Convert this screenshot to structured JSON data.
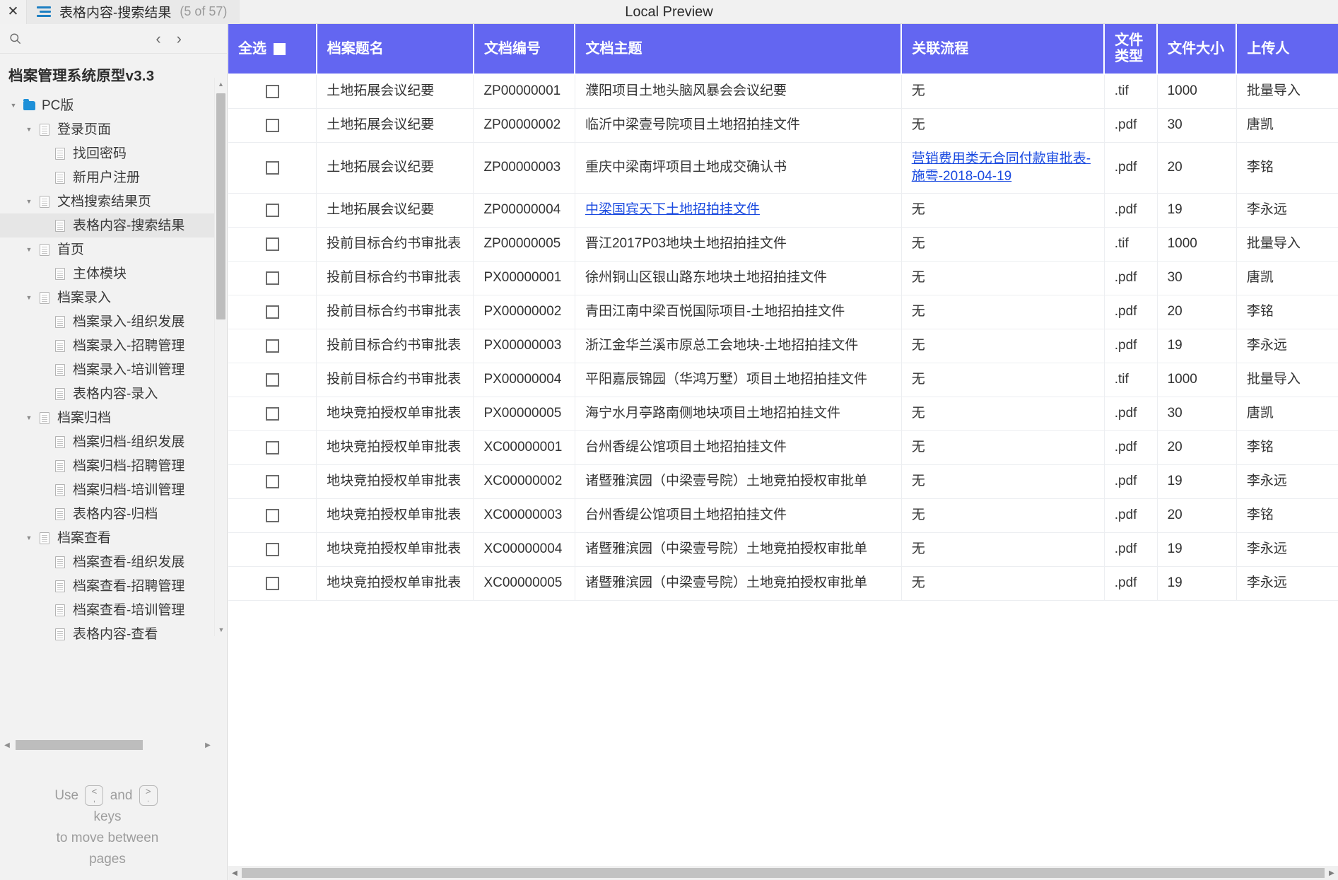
{
  "topbar": {
    "close_label": "✕",
    "tab_title": "表格内容-搜索结果",
    "tab_count": "(5 of 57)",
    "center_title": "Local Preview"
  },
  "sidebar": {
    "prev_label": "‹",
    "next_label": "›",
    "project_title": "档案管理系统原型v3.3",
    "tree": [
      {
        "label": "PC版",
        "depth": 0,
        "icon": "folder-icon",
        "caret": "▼",
        "selected": false
      },
      {
        "label": "登录页面",
        "depth": 1,
        "icon": "page-icon",
        "caret": "▼",
        "selected": false
      },
      {
        "label": "找回密码",
        "depth": 2,
        "icon": "page-icon",
        "caret": "",
        "selected": false
      },
      {
        "label": "新用户注册",
        "depth": 2,
        "icon": "page-icon",
        "caret": "",
        "selected": false
      },
      {
        "label": "文档搜索结果页",
        "depth": 1,
        "icon": "page-icon",
        "caret": "▼",
        "selected": false
      },
      {
        "label": "表格内容-搜索结果",
        "depth": 2,
        "icon": "page-icon",
        "caret": "",
        "selected": true
      },
      {
        "label": "首页",
        "depth": 1,
        "icon": "page-icon",
        "caret": "▼",
        "selected": false
      },
      {
        "label": "主体模块",
        "depth": 2,
        "icon": "page-icon",
        "caret": "",
        "selected": false
      },
      {
        "label": "档案录入",
        "depth": 1,
        "icon": "page-icon",
        "caret": "▼",
        "selected": false
      },
      {
        "label": "档案录入-组织发展",
        "depth": 2,
        "icon": "page-icon",
        "caret": "",
        "selected": false
      },
      {
        "label": "档案录入-招聘管理",
        "depth": 2,
        "icon": "page-icon",
        "caret": "",
        "selected": false
      },
      {
        "label": "档案录入-培训管理",
        "depth": 2,
        "icon": "page-icon",
        "caret": "",
        "selected": false
      },
      {
        "label": "表格内容-录入",
        "depth": 2,
        "icon": "page-icon",
        "caret": "",
        "selected": false
      },
      {
        "label": "档案归档",
        "depth": 1,
        "icon": "page-icon",
        "caret": "▼",
        "selected": false
      },
      {
        "label": "档案归档-组织发展",
        "depth": 2,
        "icon": "page-icon",
        "caret": "",
        "selected": false
      },
      {
        "label": "档案归档-招聘管理",
        "depth": 2,
        "icon": "page-icon",
        "caret": "",
        "selected": false
      },
      {
        "label": "档案归档-培训管理",
        "depth": 2,
        "icon": "page-icon",
        "caret": "",
        "selected": false
      },
      {
        "label": "表格内容-归档",
        "depth": 2,
        "icon": "page-icon",
        "caret": "",
        "selected": false
      },
      {
        "label": "档案查看",
        "depth": 1,
        "icon": "page-icon",
        "caret": "▼",
        "selected": false
      },
      {
        "label": "档案查看-组织发展",
        "depth": 2,
        "icon": "page-icon",
        "caret": "",
        "selected": false
      },
      {
        "label": "档案查看-招聘管理",
        "depth": 2,
        "icon": "page-icon",
        "caret": "",
        "selected": false
      },
      {
        "label": "档案查看-培训管理",
        "depth": 2,
        "icon": "page-icon",
        "caret": "",
        "selected": false
      },
      {
        "label": "表格内容-查看",
        "depth": 2,
        "icon": "page-icon",
        "caret": "",
        "selected": false
      }
    ],
    "hint": {
      "use": "Use",
      "key_prev_top": "<",
      "key_prev_bottom": ",",
      "and": "and",
      "key_next_top": ">",
      "key_next_bottom": ".",
      "line2": "keys",
      "line3": "to move between",
      "line4": "pages"
    }
  },
  "table": {
    "accent_color": "#6366f1",
    "link_color": "#1a4ae0",
    "headers": [
      "全选",
      "档案题名",
      "文档编号",
      "文档主题",
      "关联流程",
      "文件类型",
      "文件大小",
      "上传人"
    ],
    "rows": [
      {
        "checked": false,
        "title": "土地拓展会议纪要",
        "docno": "ZP00000001",
        "subject": "濮阳项目土地头脑风暴会会议纪要",
        "subject_link": false,
        "flow": "无",
        "flow_link": false,
        "ftype": ".tif",
        "fsize": "1000",
        "uploader": "批量导入"
      },
      {
        "checked": false,
        "title": "土地拓展会议纪要",
        "docno": "ZP00000002",
        "subject": "临沂中梁壹号院项目土地招拍挂文件",
        "subject_link": false,
        "flow": "无",
        "flow_link": false,
        "ftype": ".pdf",
        "fsize": "30",
        "uploader": "唐凯"
      },
      {
        "checked": false,
        "title": "土地拓展会议纪要",
        "docno": "ZP00000003",
        "subject": "重庆中梁南坪项目土地成交确认书",
        "subject_link": false,
        "flow": "营销费用类无合同付款审批表-施雩-2018-04-19",
        "flow_link": true,
        "ftype": ".pdf",
        "fsize": "20",
        "uploader": "李铭"
      },
      {
        "checked": false,
        "title": "土地拓展会议纪要",
        "docno": "ZP00000004",
        "subject": "中梁国宾天下土地招拍挂文件",
        "subject_link": true,
        "flow": "无",
        "flow_link": false,
        "ftype": ".pdf",
        "fsize": "19",
        "uploader": "李永远"
      },
      {
        "checked": false,
        "title": "投前目标合约书审批表",
        "docno": "ZP00000005",
        "subject": "晋江2017P03地块土地招拍挂文件",
        "subject_link": false,
        "flow": "无",
        "flow_link": false,
        "ftype": ".tif",
        "fsize": "1000",
        "uploader": "批量导入"
      },
      {
        "checked": false,
        "title": "投前目标合约书审批表",
        "docno": "PX00000001",
        "subject": "徐州铜山区银山路东地块土地招拍挂文件",
        "subject_link": false,
        "flow": "无",
        "flow_link": false,
        "ftype": ".pdf",
        "fsize": "30",
        "uploader": "唐凯"
      },
      {
        "checked": false,
        "title": "投前目标合约书审批表",
        "docno": "PX00000002",
        "subject": "青田江南中梁百悦国际项目-土地招拍挂文件",
        "subject_link": false,
        "flow": "无",
        "flow_link": false,
        "ftype": ".pdf",
        "fsize": "20",
        "uploader": "李铭"
      },
      {
        "checked": false,
        "title": "投前目标合约书审批表",
        "docno": "PX00000003",
        "subject": "浙江金华兰溪市原总工会地块-土地招拍挂文件",
        "subject_link": false,
        "flow": "无",
        "flow_link": false,
        "ftype": ".pdf",
        "fsize": "19",
        "uploader": "李永远"
      },
      {
        "checked": false,
        "title": "投前目标合约书审批表",
        "docno": "PX00000004",
        "subject": "平阳嘉辰锦园（华鸿万墅）项目土地招拍挂文件",
        "subject_link": false,
        "flow": "无",
        "flow_link": false,
        "ftype": ".tif",
        "fsize": "1000",
        "uploader": "批量导入"
      },
      {
        "checked": false,
        "title": "地块竞拍授权单审批表",
        "docno": "PX00000005",
        "subject": "海宁水月亭路南侧地块项目土地招拍挂文件",
        "subject_link": false,
        "flow": "无",
        "flow_link": false,
        "ftype": ".pdf",
        "fsize": "30",
        "uploader": "唐凯"
      },
      {
        "checked": false,
        "title": "地块竞拍授权单审批表",
        "docno": "XC00000001",
        "subject": "台州香缇公馆项目土地招拍挂文件",
        "subject_link": false,
        "flow": "无",
        "flow_link": false,
        "ftype": ".pdf",
        "fsize": "20",
        "uploader": "李铭"
      },
      {
        "checked": false,
        "title": "地块竞拍授权单审批表",
        "docno": "XC00000002",
        "subject": "诸暨雅滨园（中梁壹号院）土地竞拍授权审批单",
        "subject_link": false,
        "flow": "无",
        "flow_link": false,
        "ftype": ".pdf",
        "fsize": "19",
        "uploader": "李永远"
      },
      {
        "checked": false,
        "title": "地块竞拍授权单审批表",
        "docno": "XC00000003",
        "subject": "台州香缇公馆项目土地招拍挂文件",
        "subject_link": false,
        "flow": "无",
        "flow_link": false,
        "ftype": ".pdf",
        "fsize": "20",
        "uploader": "李铭"
      },
      {
        "checked": false,
        "title": "地块竞拍授权单审批表",
        "docno": "XC00000004",
        "subject": "诸暨雅滨园（中梁壹号院）土地竞拍授权审批单",
        "subject_link": false,
        "flow": "无",
        "flow_link": false,
        "ftype": ".pdf",
        "fsize": "19",
        "uploader": "李永远"
      },
      {
        "checked": false,
        "title": "地块竞拍授权单审批表",
        "docno": "XC00000005",
        "subject": "诸暨雅滨园（中梁壹号院）土地竞拍授权审批单",
        "subject_link": false,
        "flow": "无",
        "flow_link": false,
        "ftype": ".pdf",
        "fsize": "19",
        "uploader": "李永远"
      }
    ]
  }
}
